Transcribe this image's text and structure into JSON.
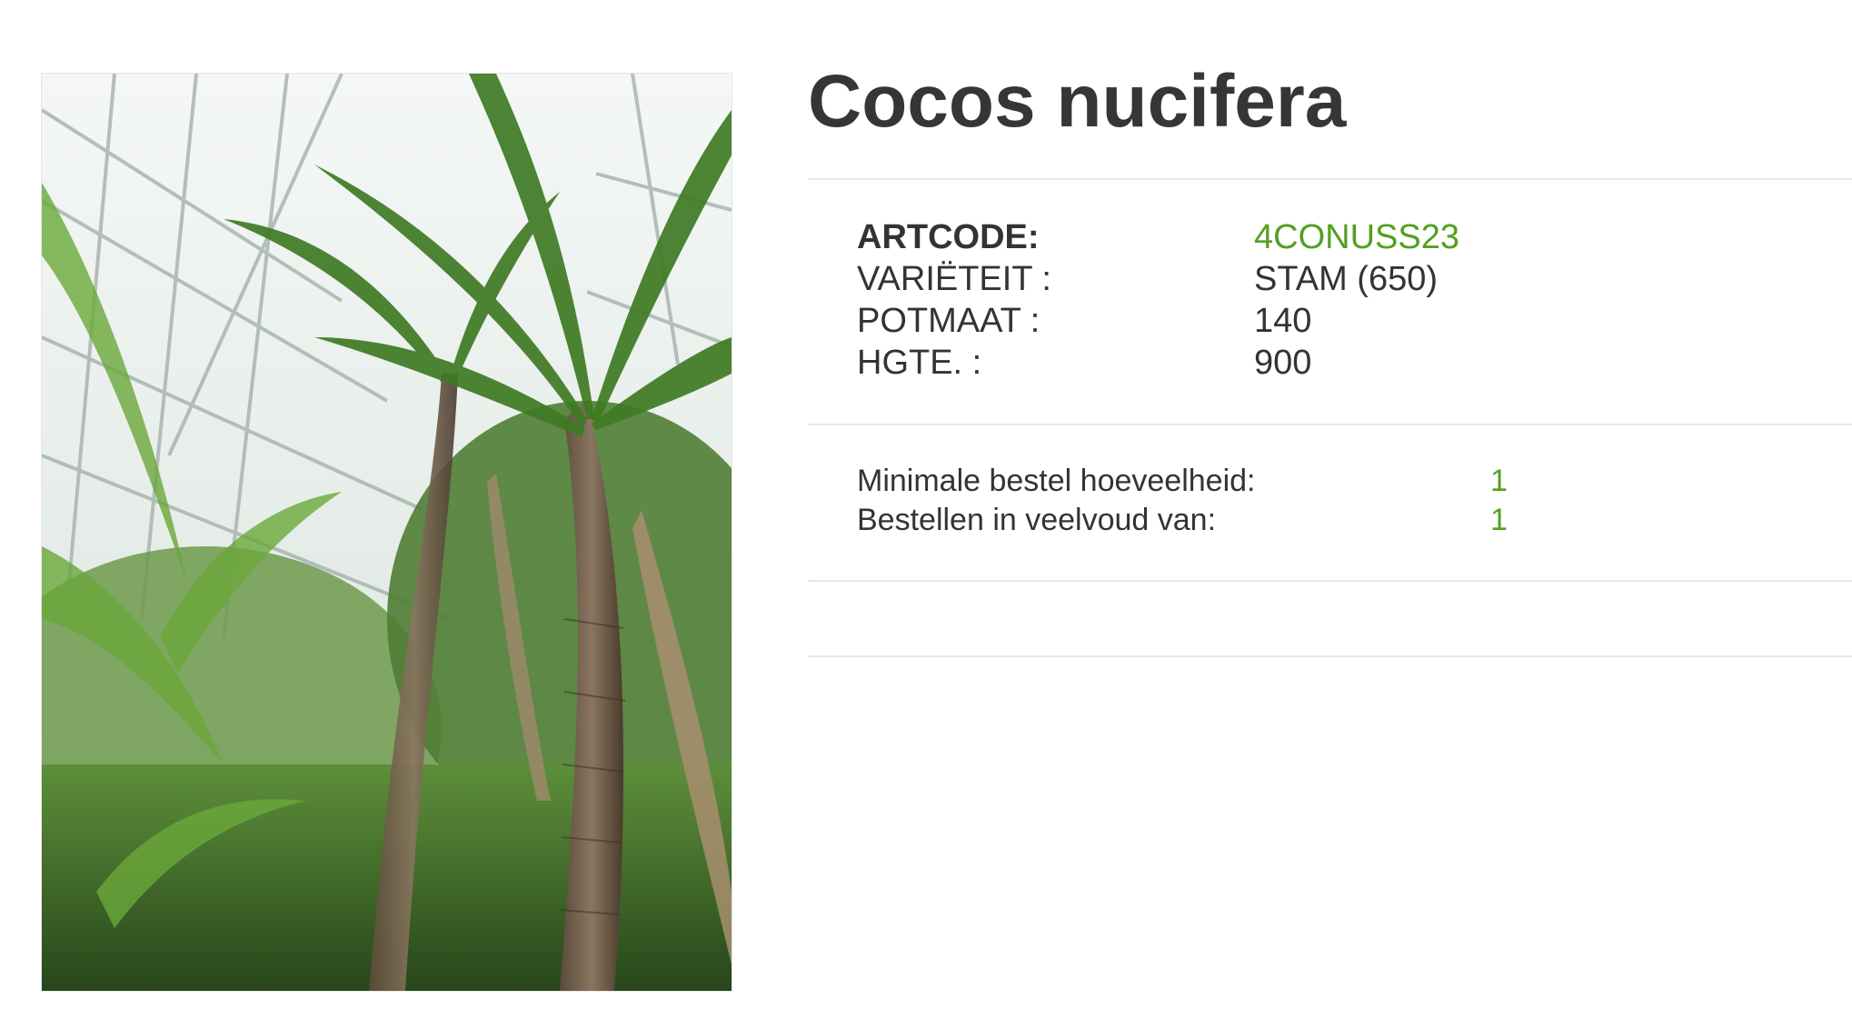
{
  "product": {
    "name": "Cocos nucifera",
    "image_subject": "coconut palm in greenhouse",
    "specs": [
      {
        "label": "ARTCODE:",
        "value": "4CONUSS23",
        "bold": true,
        "accent": true
      },
      {
        "label": "VARIËTEIT :",
        "value": "STAM (650)"
      },
      {
        "label": "POTMAAT :",
        "value": "140"
      },
      {
        "label": "HGTE. :",
        "value": "900"
      }
    ],
    "ordering": [
      {
        "label": "Minimale bestel hoeveelheid:",
        "value": "1"
      },
      {
        "label": "Bestellen in veelvoud van:",
        "value": "1"
      }
    ]
  },
  "colors": {
    "title": "#363636",
    "text": "#333333",
    "accent": "#52a01f",
    "divider": "#e8e8e8"
  }
}
